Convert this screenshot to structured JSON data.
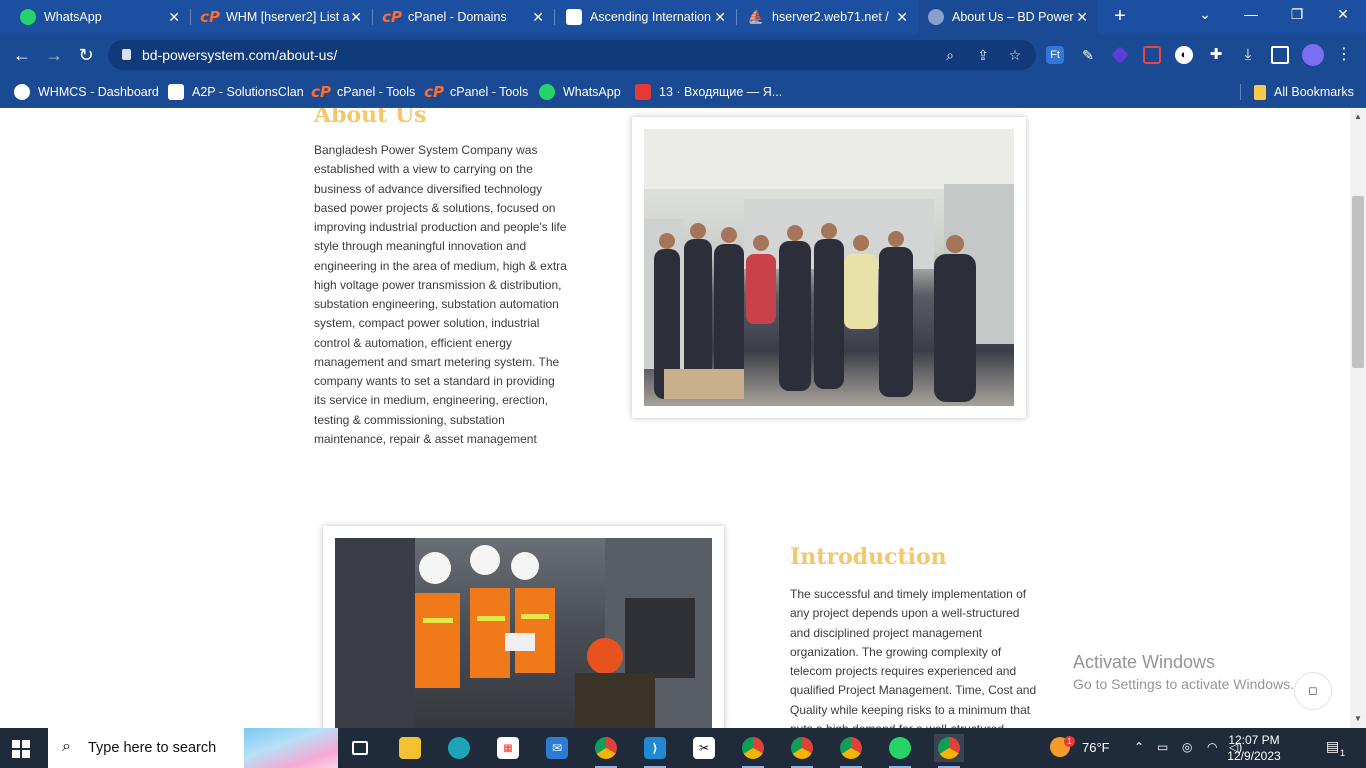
{
  "browser": {
    "tabs": [
      {
        "title": "WhatsApp",
        "icon": "whatsapp-icon"
      },
      {
        "title": "WHM [hserver2] List a",
        "icon": "cpanel-icon"
      },
      {
        "title": "cPanel - Domains",
        "icon": "cpanel-icon"
      },
      {
        "title": "Ascending Internation",
        "icon": "ascending-icon"
      },
      {
        "title": "hserver2.web71.net /",
        "icon": "phpmyadmin-icon"
      },
      {
        "title": "About Us – BD Power",
        "icon": "globe-icon",
        "active": true
      }
    ],
    "url": "bd-powersystem.com/about-us/",
    "bookmarks": [
      {
        "label": "WHMCS - Dashboard",
        "icon": "whmcs-icon"
      },
      {
        "label": "A2P - SolutionsClan",
        "icon": "a2p-icon"
      },
      {
        "label": "cPanel - Tools",
        "icon": "cpanel-icon"
      },
      {
        "label": "cPanel - Tools",
        "icon": "cpanel-icon"
      },
      {
        "label": "WhatsApp",
        "icon": "whatsapp-icon"
      },
      {
        "label": "13 · Входящие — Я...",
        "icon": "mail-icon"
      }
    ],
    "all_bookmarks": "All Bookmarks"
  },
  "page": {
    "about": {
      "title": "About Us",
      "text": "Bangladesh Power System Company was established with a view to carrying on the business of advance diversified technology based power projects & solutions, focused on improving industrial production and people's life style through meaningful innovation and engineering in the area of medium, high & extra high voltage power transmission & distribution, substation engineering, substation automation system, compact power solution, industrial control & automation, efficient energy management and smart metering system. The company wants to set a standard in providing its service in medium, engineering, erection, testing & commissioning, substation maintenance, repair & asset management"
    },
    "intro": {
      "title": "Introduction",
      "text": "The successful and timely implementation of any project depends upon a well-structured and disciplined project management organization. The growing complexity of telecom projects requires experienced and qualified Project Management. Time, Cost and Quality while keeping risks to a minimum that puts a high demand for a well-structured"
    }
  },
  "watermark": {
    "line1": "Activate Windows",
    "line2": "Go to Settings to activate Windows."
  },
  "taskbar": {
    "search_placeholder": "Type here to search",
    "weather": "76°F",
    "weather_badge": "1",
    "time": "12:07 PM",
    "date": "12/9/2023",
    "notification_count": "1"
  },
  "colors": {
    "chrome_blue": "#1a4a93",
    "heading_gold": "#f2c76d",
    "taskbar": "#1f2a3a"
  }
}
